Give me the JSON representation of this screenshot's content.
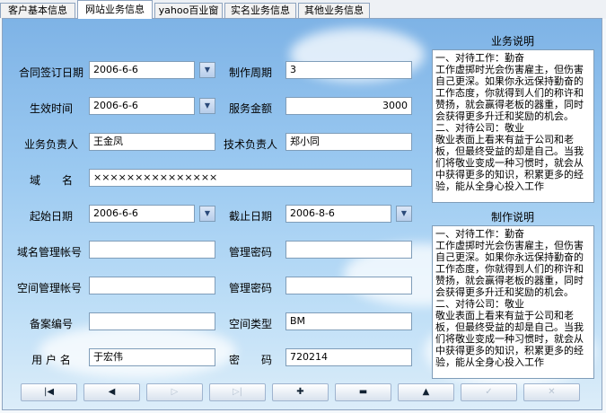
{
  "tabs": [
    {
      "label": "客户基本信息"
    },
    {
      "label": "网站业务信息"
    },
    {
      "label": "yahoo百业窗"
    },
    {
      "label": "实名业务信息"
    },
    {
      "label": "其他业务信息"
    }
  ],
  "form": {
    "sign_date_label": "合同签订日期",
    "sign_date_value": "2006-6-6",
    "cycle_label": "制作周期",
    "cycle_value": "3",
    "effective_label": "生效时间",
    "effective_value": "2006-6-6",
    "amount_label": "服务金额",
    "amount_value": "3000",
    "manager_label": "业务负责人",
    "manager_value": "王金凤",
    "tech_label": "技术负责人",
    "tech_value": "郑小同",
    "domain_label": "域　　名",
    "domain_value": "×××××××××××××××",
    "start_label": "起始日期",
    "start_value": "2006-6-6",
    "end_label": "截止日期",
    "end_value": "2006-8-6",
    "domain_acct_label": "域名管理帐号",
    "domain_acct_value": "",
    "domain_pwd_label": "管理密码",
    "domain_pwd_value": "",
    "space_acct_label": "空间管理帐号",
    "space_acct_value": "",
    "space_pwd_label": "管理密码",
    "space_pwd_value": "",
    "record_label": "备案编号",
    "record_value": "",
    "space_type_label": "空间类型",
    "space_type_value": "BM",
    "user_label": "用 户 名",
    "user_value": "于宏伟",
    "pwd_label": "密　　码",
    "pwd_value": "720214"
  },
  "side": {
    "business_title": "业务说明",
    "business_text": "一、对待工作：勤奋\n工作虚掷时光会伤害雇主，但伤害自己更深。如果你永远保持勤奋的工作态度，你就得到人们的称许和赞扬，就会赢得老板的器重，同时会获得更多升迁和奖励的机会。\n二、对待公司：敬业\n敬业表面上看来有益于公司和老板，但最终受益的却是自己。当我们将敬业变成一种习惯时，就会从中获得更多的知识，积累更多的经验，能从全身心投入工作",
    "production_title": "制作说明",
    "production_text": "一、对待工作：勤奋\n工作虚掷时光会伤害雇主，但伤害自己更深。如果你永远保持勤奋的工作态度，你就得到人们的称许和赞扬，就会赢得老板的器重，同时会获得更多升迁和奖励的机会。\n二、对待公司：敬业\n敬业表面上看来有益于公司和老板，但最终受益的却是自己。当我们将敬业变成一种习惯时，就会从中获得更多的知识，积累更多的经验，能从全身心投入工作"
  },
  "nav": {
    "first": "|◀",
    "prev": "◀",
    "next": "▷",
    "last": "▷|",
    "add": "✚",
    "delete": "▬",
    "up": "▲",
    "confirm": "✓",
    "cancel": "✕"
  },
  "icons": {
    "dropdown": "dropdown-arrow-icon"
  }
}
